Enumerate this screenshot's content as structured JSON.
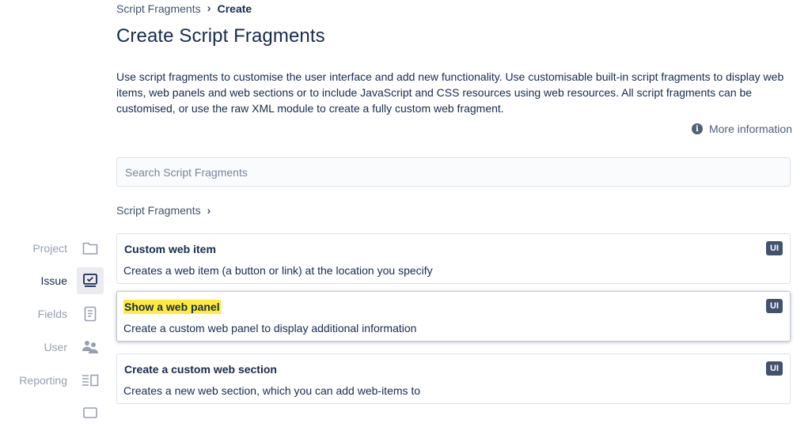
{
  "breadcrumb": {
    "parent": "Script Fragments",
    "separator": "›",
    "current": "Create"
  },
  "page_title": "Create Script Fragments",
  "description": "Use script fragments to customise the user interface and add new functionality. Use customisable built-in script fragments to display web items, web panels and web sections or to include JavaScript and CSS resources using web resources. All script fragments can be customised, or use the raw XML module to create a fully custom web fragment.",
  "more_info": {
    "icon": "info-icon",
    "label": "More information"
  },
  "search": {
    "placeholder": "Search Script Fragments",
    "value": ""
  },
  "section": {
    "label": "Script Fragments",
    "chevron": "›"
  },
  "sidebar": {
    "items": [
      {
        "label": "Project",
        "icon": "folder-icon",
        "active": false
      },
      {
        "label": "Issue",
        "icon": "issue-icon",
        "active": true
      },
      {
        "label": "Fields",
        "icon": "fields-icon",
        "active": false
      },
      {
        "label": "User",
        "icon": "users-icon",
        "active": false
      },
      {
        "label": "Reporting",
        "icon": "reporting-icon",
        "active": false
      }
    ]
  },
  "cards": [
    {
      "title": "Custom web item",
      "description": "Creates a web item (a button or link) at the location you specify",
      "badge": "UI"
    },
    {
      "title": "Show a web panel",
      "description": "Create a custom web panel to display additional information",
      "badge": "UI",
      "highlighted": true
    },
    {
      "title": "Create a custom web section",
      "description": "Creates a new web section, which you can add web-items to",
      "badge": "UI"
    }
  ],
  "colors": {
    "text": "#172b4d",
    "muted": "#97a0af",
    "badge": "#42526e",
    "highlight": "#ffeb3b"
  }
}
